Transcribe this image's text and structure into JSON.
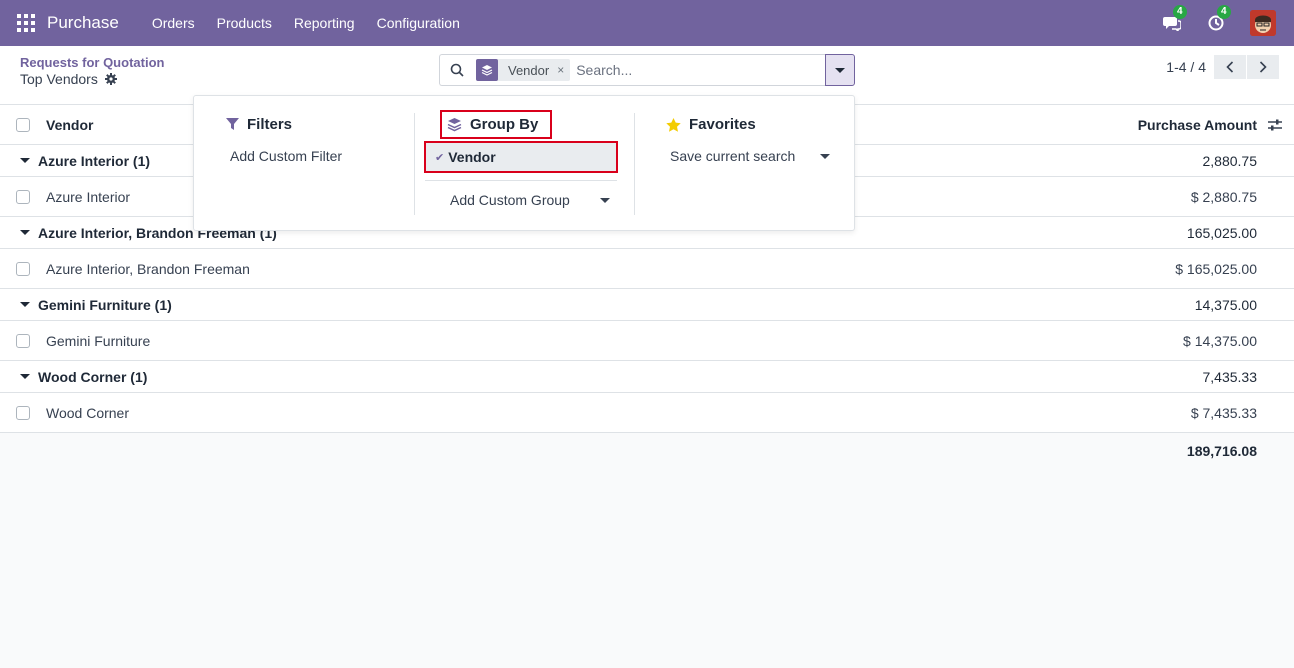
{
  "navbar": {
    "brand": "Purchase",
    "menu": [
      "Orders",
      "Products",
      "Reporting",
      "Configuration"
    ],
    "messages_count": "4",
    "activities_count": "4",
    "bg_color": "#71639e"
  },
  "control_panel": {
    "breadcrumb_parent": "Requests for Quotation",
    "breadcrumb_current": "Top Vendors",
    "search": {
      "facet_label": "Vendor",
      "facet_remove": "×",
      "placeholder": "Search..."
    },
    "pager": "1-4 / 4"
  },
  "list": {
    "columns": {
      "vendor": "Vendor",
      "amount": "Purchase Amount"
    },
    "groups": [
      {
        "label": "Azure Interior (1)",
        "total": "2,880.75",
        "record": {
          "vendor": "Azure Interior",
          "amount": "$ 2,880.75"
        }
      },
      {
        "label": "Azure Interior, Brandon Freeman (1)",
        "total": "165,025.00",
        "record": {
          "vendor": "Azure Interior, Brandon Freeman",
          "amount": "$ 165,025.00"
        }
      },
      {
        "label": "Gemini Furniture (1)",
        "total": "14,375.00",
        "record": {
          "vendor": "Gemini Furniture",
          "amount": "$ 14,375.00"
        }
      },
      {
        "label": "Wood Corner (1)",
        "total": "7,435.33",
        "record": {
          "vendor": "Wood Corner",
          "amount": "$ 7,435.33"
        }
      }
    ],
    "grand_total": "189,716.08"
  },
  "dropdown": {
    "filters": {
      "title": "Filters",
      "add_custom": "Add Custom Filter"
    },
    "group_by": {
      "title": "Group By",
      "selected_option": "Vendor",
      "add_custom": "Add Custom Group"
    },
    "favorites": {
      "title": "Favorites",
      "save_current": "Save current search"
    },
    "highlight_color": "#d9001b"
  }
}
